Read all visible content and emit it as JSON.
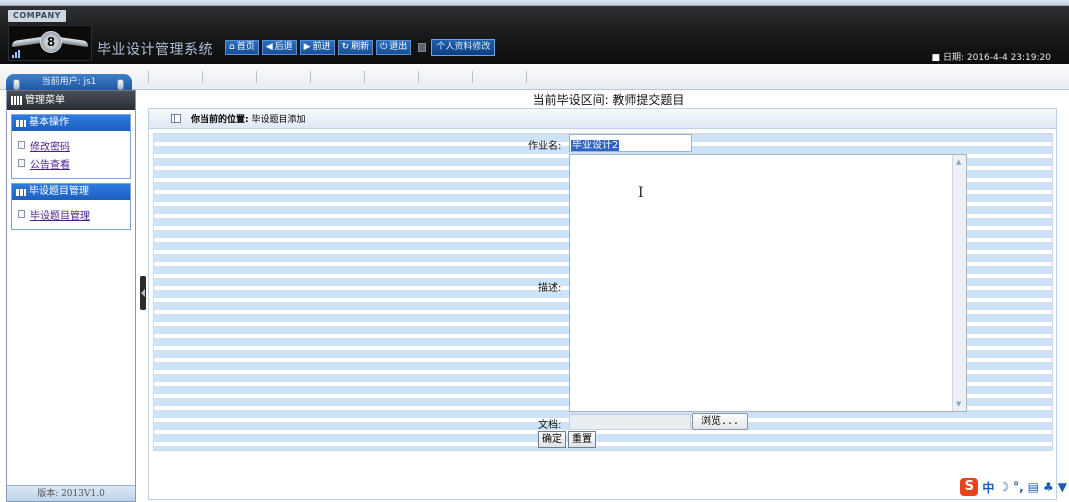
{
  "header": {
    "company": "COMPANY",
    "logo_badge": "8",
    "title": "毕业设计管理系统",
    "nav": [
      {
        "icon": "home-icon",
        "glyph": "⌂",
        "label": "首页"
      },
      {
        "icon": "back-icon",
        "glyph": "◀",
        "label": "后退"
      },
      {
        "icon": "forward-icon",
        "glyph": "▶",
        "label": "前进"
      },
      {
        "icon": "refresh-icon",
        "glyph": "↻",
        "label": "刷新"
      },
      {
        "icon": "power-icon",
        "glyph": "⏻",
        "label": "退出"
      }
    ],
    "profile_label": "个人资料修改",
    "date_label": "日期:",
    "date_value": "2016-4-4 23:19:20"
  },
  "user": {
    "label": "当前用户: js1"
  },
  "sidebar": {
    "menu_title": "管理菜单",
    "sections": [
      {
        "title": "基本操作",
        "links": [
          "修改密码",
          "公告查看"
        ]
      },
      {
        "title": "毕设题目管理",
        "links": [
          "毕设题目管理"
        ]
      }
    ],
    "version": "版本: 2013V1.0"
  },
  "main": {
    "title": "当前毕设区间: 教师提交题目",
    "location_label": "你当前的位置:",
    "location_value": "毕设题目添加"
  },
  "form": {
    "name_label": "作业名:",
    "name_value": "毕业设计2",
    "desc_label": "描述:",
    "file_label": "文档:",
    "browse_label": "浏览...",
    "submit_label": "确定",
    "reset_label": "重置"
  },
  "ime": {
    "logo": "S",
    "lang": "中"
  },
  "colors": {
    "header_bg": "#151617",
    "nav_button": "#1f5aa3",
    "section_header": "#2f7be0",
    "form_stripe": "#cfe3f6"
  }
}
